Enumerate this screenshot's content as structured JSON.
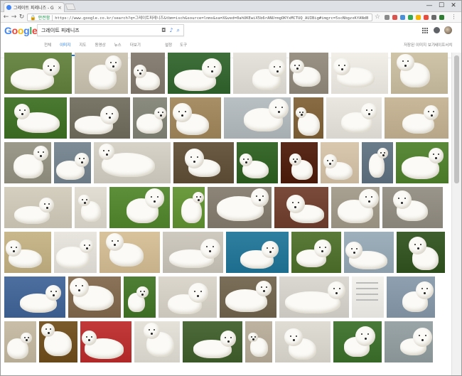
{
  "browser": {
    "tab_title": "그레이트 피레니즈 - G",
    "tab_close": "×",
    "window_controls": [
      "—",
      "☐",
      "✕"
    ],
    "secure_label": "안전함",
    "url": "https://www.google.co.kr/search?q=그레이트피레니즈&tbm=isch&source=lnms&sa=X&ved=0ahUKEwiX5b6rANUrmgOKYxMCTUQ_AUIBig#imgrc=5scNbgzxKfANdB"
  },
  "google": {
    "logo_letters": [
      {
        "ch": "G",
        "color": "#4285f4"
      },
      {
        "ch": "o",
        "color": "#ea4335"
      },
      {
        "ch": "o",
        "color": "#fbbc05"
      },
      {
        "ch": "g",
        "color": "#4285f4"
      },
      {
        "ch": "l",
        "color": "#34a853"
      },
      {
        "ch": "e",
        "color": "#ea4335"
      }
    ],
    "query": "그레이트 피레니즈",
    "tabs": [
      {
        "label": "전체",
        "active": false
      },
      {
        "label": "이미지",
        "active": true
      },
      {
        "label": "지도",
        "active": false
      },
      {
        "label": "동영상",
        "active": false
      },
      {
        "label": "뉴스",
        "active": false
      },
      {
        "label": "더보기",
        "active": false
      }
    ],
    "settings_label": "설정",
    "tools_label": "도구",
    "saved_images_label": "저장된 이미지 보기",
    "safesearch_label": "세이프서치"
  },
  "colors": {
    "accent": "#1a73e8",
    "secure": "#0a8a3a"
  },
  "image_rows": [
    [
      {
        "w": 95,
        "bg": "#6d8a4a",
        "dog": true
      },
      {
        "w": 75,
        "bg": "#cfc7b6",
        "dog": true
      },
      {
        "w": 48,
        "bg": "#8a8276",
        "dog": true
      },
      {
        "w": 88,
        "bg": "#3f6f3a",
        "dog": true
      },
      {
        "w": 75,
        "bg": "#e6e3dc",
        "dog": true
      },
      {
        "w": 55,
        "bg": "#9a9385",
        "dog": true
      },
      {
        "w": 80,
        "bg": "#f1efe8",
        "dog": true
      },
      {
        "w": 80,
        "bg": "#d0c4a8",
        "dog": true
      }
    ],
    [
      {
        "w": 88,
        "bg": "#4b7a32",
        "dog": true
      },
      {
        "w": 85,
        "bg": "#7a7668",
        "dog": true
      },
      {
        "w": 48,
        "bg": "#8b8c80",
        "dog": true
      },
      {
        "w": 72,
        "bg": "#a98f66",
        "dog": true
      },
      {
        "w": 94,
        "bg": "#b9c0c4",
        "dog": true
      },
      {
        "w": 42,
        "bg": "#8a6c44",
        "dog": true
      },
      {
        "w": 78,
        "bg": "#eae7e0",
        "dog": true
      },
      {
        "w": 90,
        "bg": "#c9b99a",
        "dog": true
      }
    ],
    [
      {
        "w": 66,
        "bg": "#9c9a8a",
        "dog": true
      },
      {
        "w": 52,
        "bg": "#7d8c96",
        "dog": true
      },
      {
        "w": 108,
        "bg": "#d7d3c8",
        "dog": true
      },
      {
        "w": 85,
        "bg": "#6b5b45",
        "dog": true
      },
      {
        "w": 58,
        "bg": "#3c6b2f",
        "dog": true
      },
      {
        "w": 52,
        "bg": "#5a2a1a",
        "dog": true
      },
      {
        "w": 54,
        "bg": "#d9c8ae",
        "dog": true
      },
      {
        "w": 44,
        "bg": "#6a7b8a",
        "dog": true
      },
      {
        "w": 74,
        "bg": "#5a8a3a",
        "dog": true
      }
    ],
    [
      {
        "w": 95,
        "bg": "#d5cfc0",
        "dog": true
      },
      {
        "w": 45,
        "bg": "#e2ded4",
        "dog": true
      },
      {
        "w": 85,
        "bg": "#5d8f3a",
        "dog": true
      },
      {
        "w": 45,
        "bg": "#6c9a3e",
        "dog": true
      },
      {
        "w": 90,
        "bg": "#8c8578",
        "dog": true
      },
      {
        "w": 76,
        "bg": "#7a4a3a",
        "dog": true
      },
      {
        "w": 68,
        "bg": "#a8a090",
        "dog": true
      },
      {
        "w": 85,
        "bg": "#9a958a",
        "dog": true
      }
    ],
    [
      {
        "w": 66,
        "bg": "#c9b88c",
        "dog": true
      },
      {
        "w": 60,
        "bg": "#e8e6df",
        "dog": true
      },
      {
        "w": 85,
        "bg": "#d8c39c",
        "dog": true
      },
      {
        "w": 85,
        "bg": "#cfcac0",
        "dog": true
      },
      {
        "w": 88,
        "bg": "#2f7fa0",
        "dog": true
      },
      {
        "w": 70,
        "bg": "#5a7a3a",
        "dog": true
      },
      {
        "w": 70,
        "bg": "#9fb0bd",
        "dog": true
      },
      {
        "w": 68,
        "bg": "#3f5f2f",
        "dog": true
      }
    ],
    [
      {
        "w": 86,
        "bg": "#4d6fa0",
        "dog": true
      },
      {
        "w": 74,
        "bg": "#8a7358",
        "dog": true
      },
      {
        "w": 45,
        "bg": "#4f7f35",
        "dog": true
      },
      {
        "w": 82,
        "bg": "#dcd7cd",
        "dog": true
      },
      {
        "w": 80,
        "bg": "#7b6f5a",
        "dog": true
      },
      {
        "w": 98,
        "bg": "#dbd8d1",
        "dog": true
      },
      {
        "w": 45,
        "bg": "#f4f2ec",
        "dog": false
      },
      {
        "w": 68,
        "bg": "#8fa0b0",
        "dog": true
      }
    ],
    [
      {
        "w": 45,
        "bg": "#c9bea8",
        "dog": true
      },
      {
        "w": 54,
        "bg": "#7a5a2a",
        "dog": true
      },
      {
        "w": 72,
        "bg": "#c23a3a",
        "dog": true
      },
      {
        "w": 64,
        "bg": "#e5e2da",
        "dog": true
      },
      {
        "w": 84,
        "bg": "#4d6a3a",
        "dog": true
      },
      {
        "w": 38,
        "bg": "#bdb3a0",
        "dog": true
      },
      {
        "w": 78,
        "bg": "#e0ddd4",
        "dog": true
      },
      {
        "w": 68,
        "bg": "#4a7a3a",
        "dog": true
      },
      {
        "w": 68,
        "bg": "#9aa5a8",
        "dog": true
      }
    ]
  ]
}
